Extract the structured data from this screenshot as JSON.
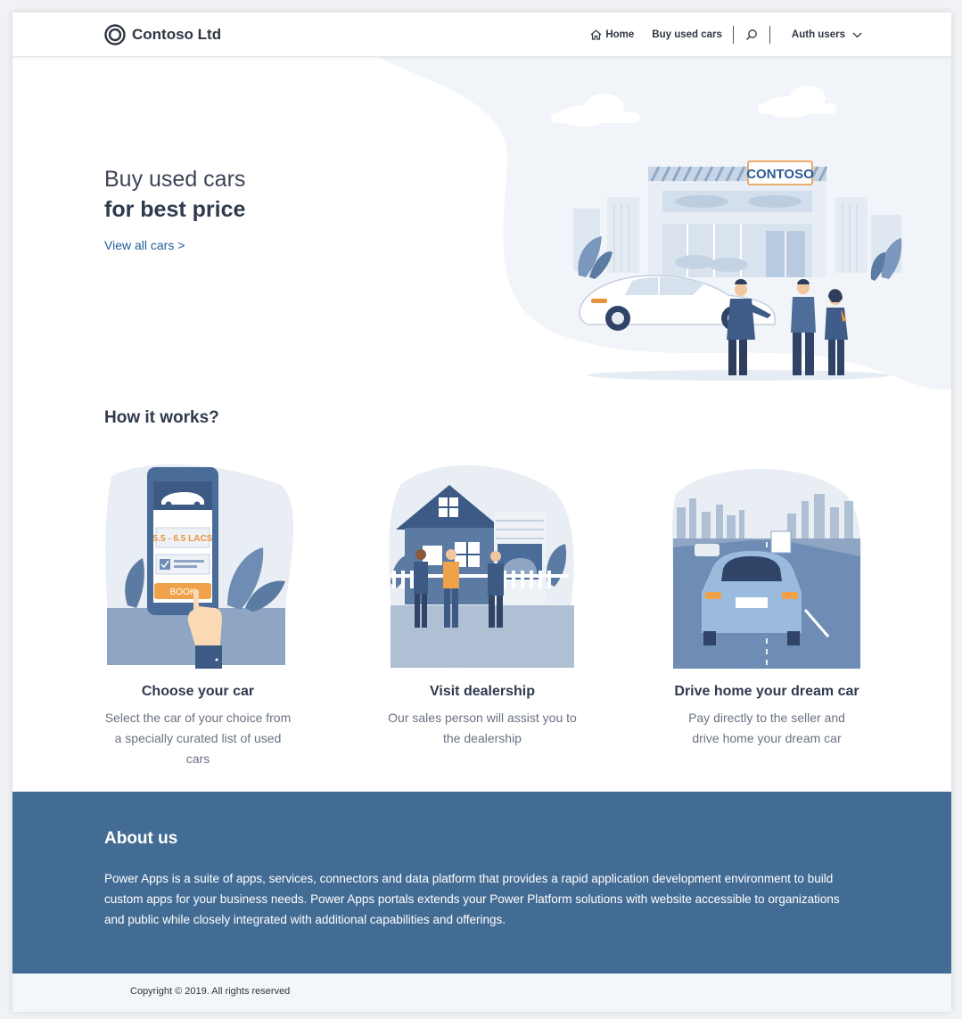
{
  "header": {
    "brand_name": "Contoso Ltd",
    "nav": {
      "home": "Home",
      "buy_used_cars": "Buy used cars",
      "auth_users": "Auth users"
    }
  },
  "hero": {
    "title_line1": "Buy used cars",
    "title_line2": "for best price",
    "link": "View all cars >",
    "sign": "CONTOSO"
  },
  "how_it_works": {
    "title": "How it works?",
    "steps": [
      {
        "title": "Choose your car",
        "description": "Select the car of your choice from a specially curated list of used cars",
        "phone_price": "5.5 - 6.5 LACS",
        "phone_button": "BOOK"
      },
      {
        "title": "Visit dealership",
        "description": "Our sales person will assist you to the dealership"
      },
      {
        "title": "Drive home your dream car",
        "description": "Pay directly to the seller and drive home your dream car"
      }
    ]
  },
  "about": {
    "title": "About us",
    "text": "Power Apps is a suite of apps, services, connectors and data platform that provides a rapid application development environment to build custom apps for your business needs. Power Apps portals extends your Power Platform solutions with website accessible to organizations and public while closely integrated with additional capabilities and offerings."
  },
  "footer": {
    "copyright": "Copyright © 2019. All rights reserved"
  },
  "colors": {
    "accent": "#1f5f9e",
    "about_bg": "#436c95",
    "illustration_blue": "#5b7ba3",
    "illustration_orange": "#f0a24a"
  }
}
